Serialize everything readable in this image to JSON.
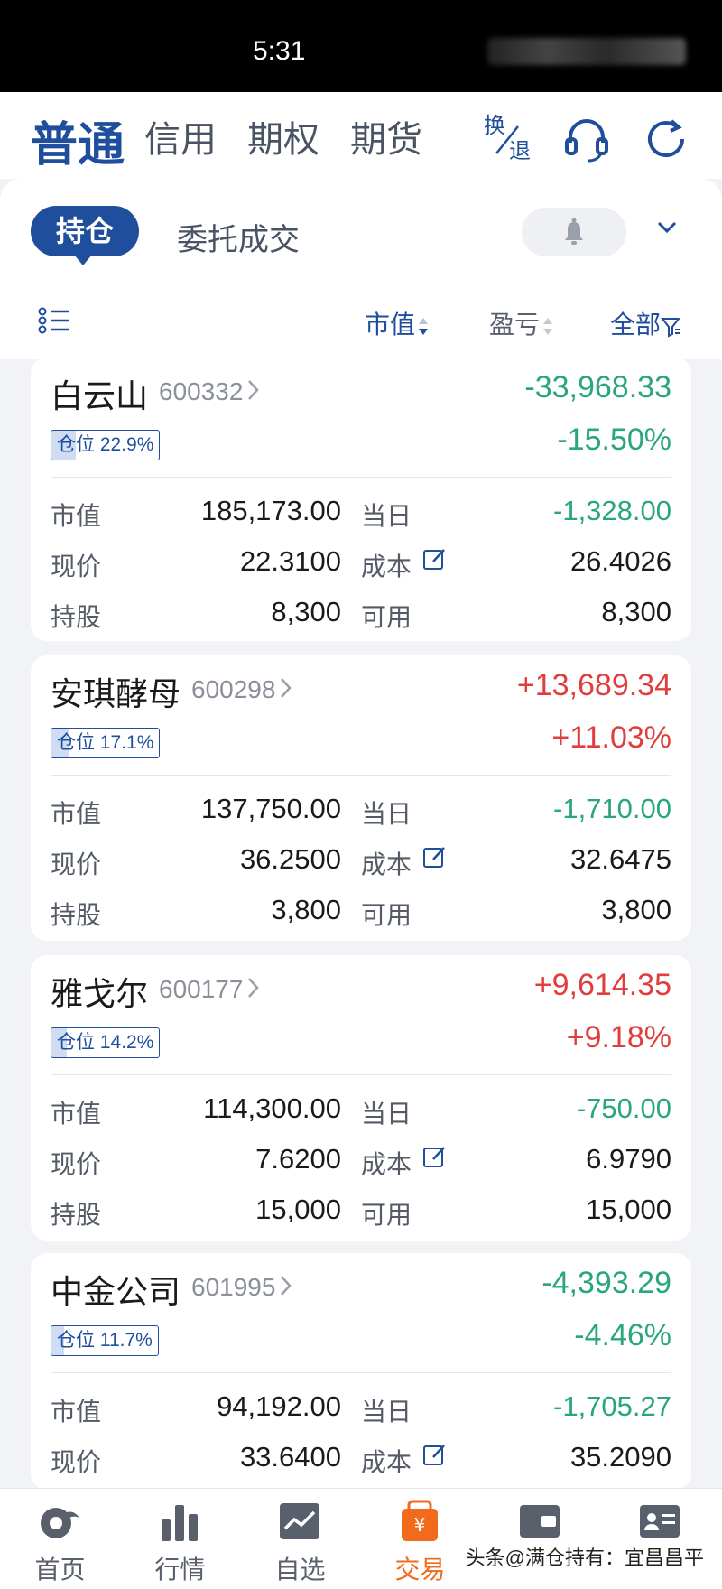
{
  "status_bar": {
    "time": "5:31"
  },
  "account_tabs": [
    {
      "label": "普通",
      "active": true
    },
    {
      "label": "信用",
      "active": false
    },
    {
      "label": "期权",
      "active": false
    },
    {
      "label": "期货",
      "active": false
    }
  ],
  "top_actions": {
    "switch_top": "换",
    "switch_bottom": "退"
  },
  "tabs": {
    "active": "持仓",
    "other": "委托成交"
  },
  "columns": {
    "market_value": "市值",
    "profit_loss": "盈亏",
    "filter": "全部"
  },
  "labels": {
    "market_value": "市值",
    "today": "当日",
    "price": "现价",
    "cost": "成本",
    "shares": "持股",
    "available": "可用",
    "position_prefix": "仓位"
  },
  "holdings": [
    {
      "name": "白云山",
      "code": "600332",
      "position": "22.9%",
      "position_fraction": 0.229,
      "pl": "-33,968.33",
      "pl_pct": "-15.50%",
      "pl_dir": "down",
      "market_value": "185,173.00",
      "today": "-1,328.00",
      "today_dir": "down",
      "price": "22.3100",
      "cost": "26.4026",
      "shares": "8,300",
      "available": "8,300"
    },
    {
      "name": "安琪酵母",
      "code": "600298",
      "position": "17.1%",
      "position_fraction": 0.171,
      "pl": "+13,689.34",
      "pl_pct": "+11.03%",
      "pl_dir": "up",
      "market_value": "137,750.00",
      "today": "-1,710.00",
      "today_dir": "down",
      "price": "36.2500",
      "cost": "32.6475",
      "shares": "3,800",
      "available": "3,800"
    },
    {
      "name": "雅戈尔",
      "code": "600177",
      "position": "14.2%",
      "position_fraction": 0.142,
      "pl": "+9,614.35",
      "pl_pct": "+9.18%",
      "pl_dir": "up",
      "market_value": "114,300.00",
      "today": "-750.00",
      "today_dir": "down",
      "price": "7.6200",
      "cost": "6.9790",
      "shares": "15,000",
      "available": "15,000"
    },
    {
      "name": "中金公司",
      "code": "601995",
      "position": "11.7%",
      "position_fraction": 0.117,
      "pl": "-4,393.29",
      "pl_pct": "-4.46%",
      "pl_dir": "down",
      "market_value": "94,192.00",
      "today": "-1,705.27",
      "today_dir": "down",
      "price": "33.6400",
      "cost": "35.2090",
      "shares": "",
      "available": ""
    }
  ],
  "bottom_nav": [
    {
      "label": "首页",
      "icon": "home-icon",
      "active": false
    },
    {
      "label": "行情",
      "icon": "bar-chart-icon",
      "active": false
    },
    {
      "label": "自选",
      "icon": "line-chart-icon",
      "active": false
    },
    {
      "label": "交易",
      "icon": "yen-bag-icon",
      "active": true
    },
    {
      "label": "",
      "icon": "wallet-icon",
      "active": false
    },
    {
      "label": "",
      "icon": "profile-card-icon",
      "active": false
    }
  ],
  "watermark": "头条@满仓持有：宜昌昌平",
  "colors": {
    "brand": "#1f4e9c",
    "up": "#e03e3e",
    "down": "#2aa67f",
    "trade_active": "#f26a1b"
  }
}
